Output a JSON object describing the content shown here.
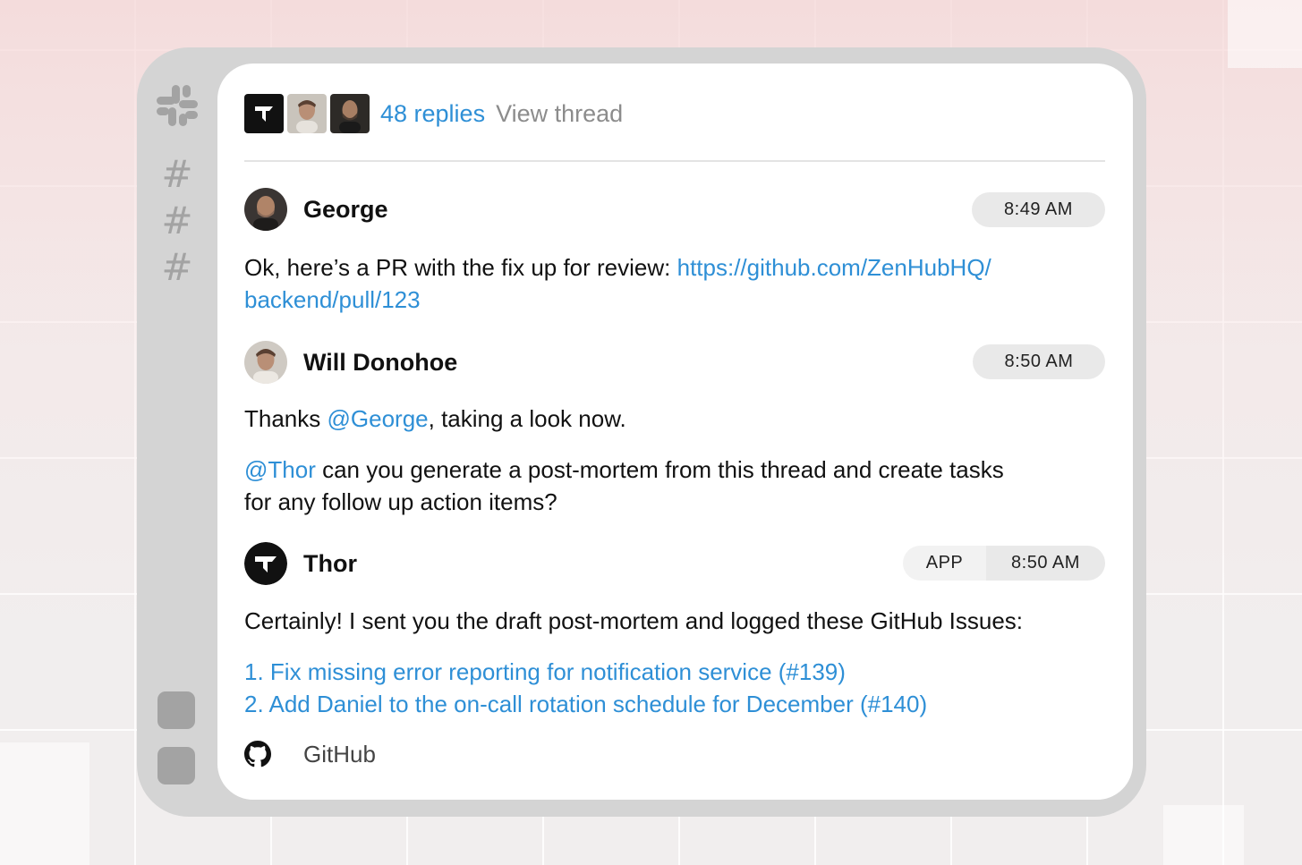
{
  "thread": {
    "replies": "48 replies",
    "view_thread": "View thread"
  },
  "messages": [
    {
      "author": "George",
      "time": "8:49 AM",
      "text_before": "Ok, here’s a PR with the fix up for review: ",
      "link_line1": "https://github.com/ZenHubHQ/",
      "link_line2": "backend/pull/123"
    },
    {
      "author": "Will Donohoe",
      "time": "8:50 AM",
      "p1_before": "Thanks ",
      "p1_mention": "@George",
      "p1_after": ", taking a look now.",
      "p2_mention": "@Thor",
      "p2_line1": " can you generate a post-mortem from this thread and create tasks",
      "p2_line2": "for any follow up action items?"
    },
    {
      "author": "Thor",
      "badge": "APP",
      "time": "8:50 AM",
      "text": "Certainly! I sent you the draft post-mortem and logged these GitHub Issues:",
      "issues": [
        "1. Fix missing error reporting for notification service (#139)",
        "2. Add Daniel to the on-call rotation schedule for December (#140)"
      ],
      "source": "GitHub"
    }
  ],
  "colors": {
    "link": "#2e8fd6",
    "frame": "#d4d4d4",
    "rail_icon": "#a3a3a3",
    "pill": "#e9e9e9"
  },
  "icons": [
    "slack-logo-icon",
    "channel-hash-icon",
    "github-icon"
  ]
}
